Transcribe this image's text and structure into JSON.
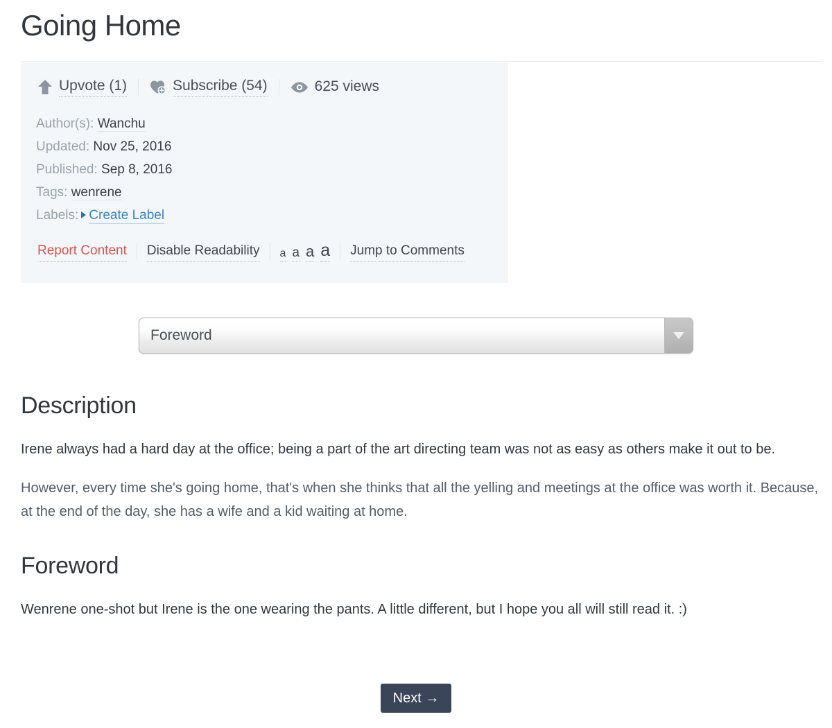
{
  "page": {
    "title": "Going Home"
  },
  "actions": [
    {
      "icon": "upvote-arrow-icon",
      "label": "Upvote (1)",
      "underlined": true
    },
    {
      "icon": "heart-plus-icon",
      "label": "Subscribe (54)",
      "underlined": true
    },
    {
      "icon": "eye-icon",
      "label": "625 views",
      "underlined": false
    }
  ],
  "meta": {
    "author_label": "Author(s):",
    "author_value": "Wanchu",
    "updated_label": "Updated:",
    "updated_value": "Nov 25, 2016",
    "published_label": "Published:",
    "published_value": "Sep 8, 2016",
    "tags_label": "Tags:",
    "tags_value": "wenrene",
    "labels_label": "Labels:",
    "create_label_link": "Create Label"
  },
  "tools": {
    "report": "Report Content",
    "readability": "Disable Readability",
    "font_sizes": [
      "a",
      "a",
      "a",
      "a"
    ],
    "jump_comments": "Jump to Comments"
  },
  "chapter_select": {
    "value": "Foreword",
    "options": [
      "Foreword"
    ]
  },
  "sections": [
    {
      "heading": "Description",
      "paragraphs": [
        "Irene always had a hard day at the office; being a part of the art directing team was not as easy as others make it out to be.",
        "However, every time she's going home, that's when she thinks that all the yelling and meetings at the office was worth it. Because, at the end of the day, she has a wife and a kid waiting at home."
      ]
    },
    {
      "heading": "Foreword",
      "paragraphs": [
        "Wenrene one-shot but Irene is the one wearing the pants. A little different, but I hope you all will still read it. :)"
      ]
    }
  ],
  "footer": {
    "next_label": "Next →"
  },
  "colors": {
    "panel_bg": "#f4f7f9",
    "link_blue": "#3b83c8",
    "danger_red": "#d9534f",
    "button_dark": "#3a4657",
    "text_dark": "#33373c",
    "text_muted": "#9aa3ab"
  }
}
